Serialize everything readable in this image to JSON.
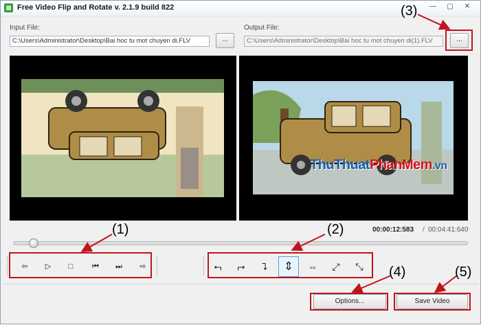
{
  "window": {
    "title": "Free Video Flip and Rotate  v. 2.1.9 build 822",
    "controls": {
      "minimize": "—",
      "maximize": "▢",
      "close": "✕"
    }
  },
  "input": {
    "label": "Input File:",
    "value": "C:\\Users\\Administrator\\Desktop\\Bai hoc tu mot chuyen di.FLV",
    "browse_label": "..."
  },
  "output": {
    "label": "Output File:",
    "value": "C:\\Users\\Administrator\\Desktop\\Bai hoc tu mot chuyen di(1).FLV",
    "browse_label": "..."
  },
  "watermark": {
    "part1": "ThuThuat",
    "part2": "PhanMem",
    "part3": ".vn"
  },
  "playback": {
    "current_time": "00:00:12:583",
    "separator": "/",
    "total_time": "00:04:41:640",
    "position": 0.045,
    "controls": [
      {
        "name": "step-back-icon",
        "glyph": "⇦"
      },
      {
        "name": "play-icon",
        "glyph": "▷"
      },
      {
        "name": "stop-icon",
        "glyph": "□"
      },
      {
        "name": "previous-frame-icon",
        "glyph": "⏮"
      },
      {
        "name": "next-frame-icon",
        "glyph": "⏭"
      },
      {
        "name": "step-forward-icon",
        "glyph": "⇨"
      }
    ]
  },
  "transforms": [
    {
      "name": "rotate-left-icon",
      "glyph": "⮢"
    },
    {
      "name": "rotate-right-icon",
      "glyph": "⮣"
    },
    {
      "name": "rotate-down-icon",
      "glyph": "⮧"
    },
    {
      "name": "flip-vertical-icon",
      "glyph": "⇕",
      "active": true
    },
    {
      "name": "flip-horizontal-icon",
      "glyph": "⇔"
    },
    {
      "name": "rotate-diagonal-icon",
      "glyph": "⤢"
    },
    {
      "name": "rotate-antidiagonal-icon",
      "glyph": "⤡"
    }
  ],
  "buttons": {
    "options": "Options...",
    "save": "Save Video"
  },
  "annotations": [
    "(1)",
    "(2)",
    "(3)",
    "(4)",
    "(5)"
  ],
  "colors": {
    "annotation": "#c0141b",
    "watermark_blue": "#1d5fad",
    "watermark_red": "#d0161d"
  }
}
